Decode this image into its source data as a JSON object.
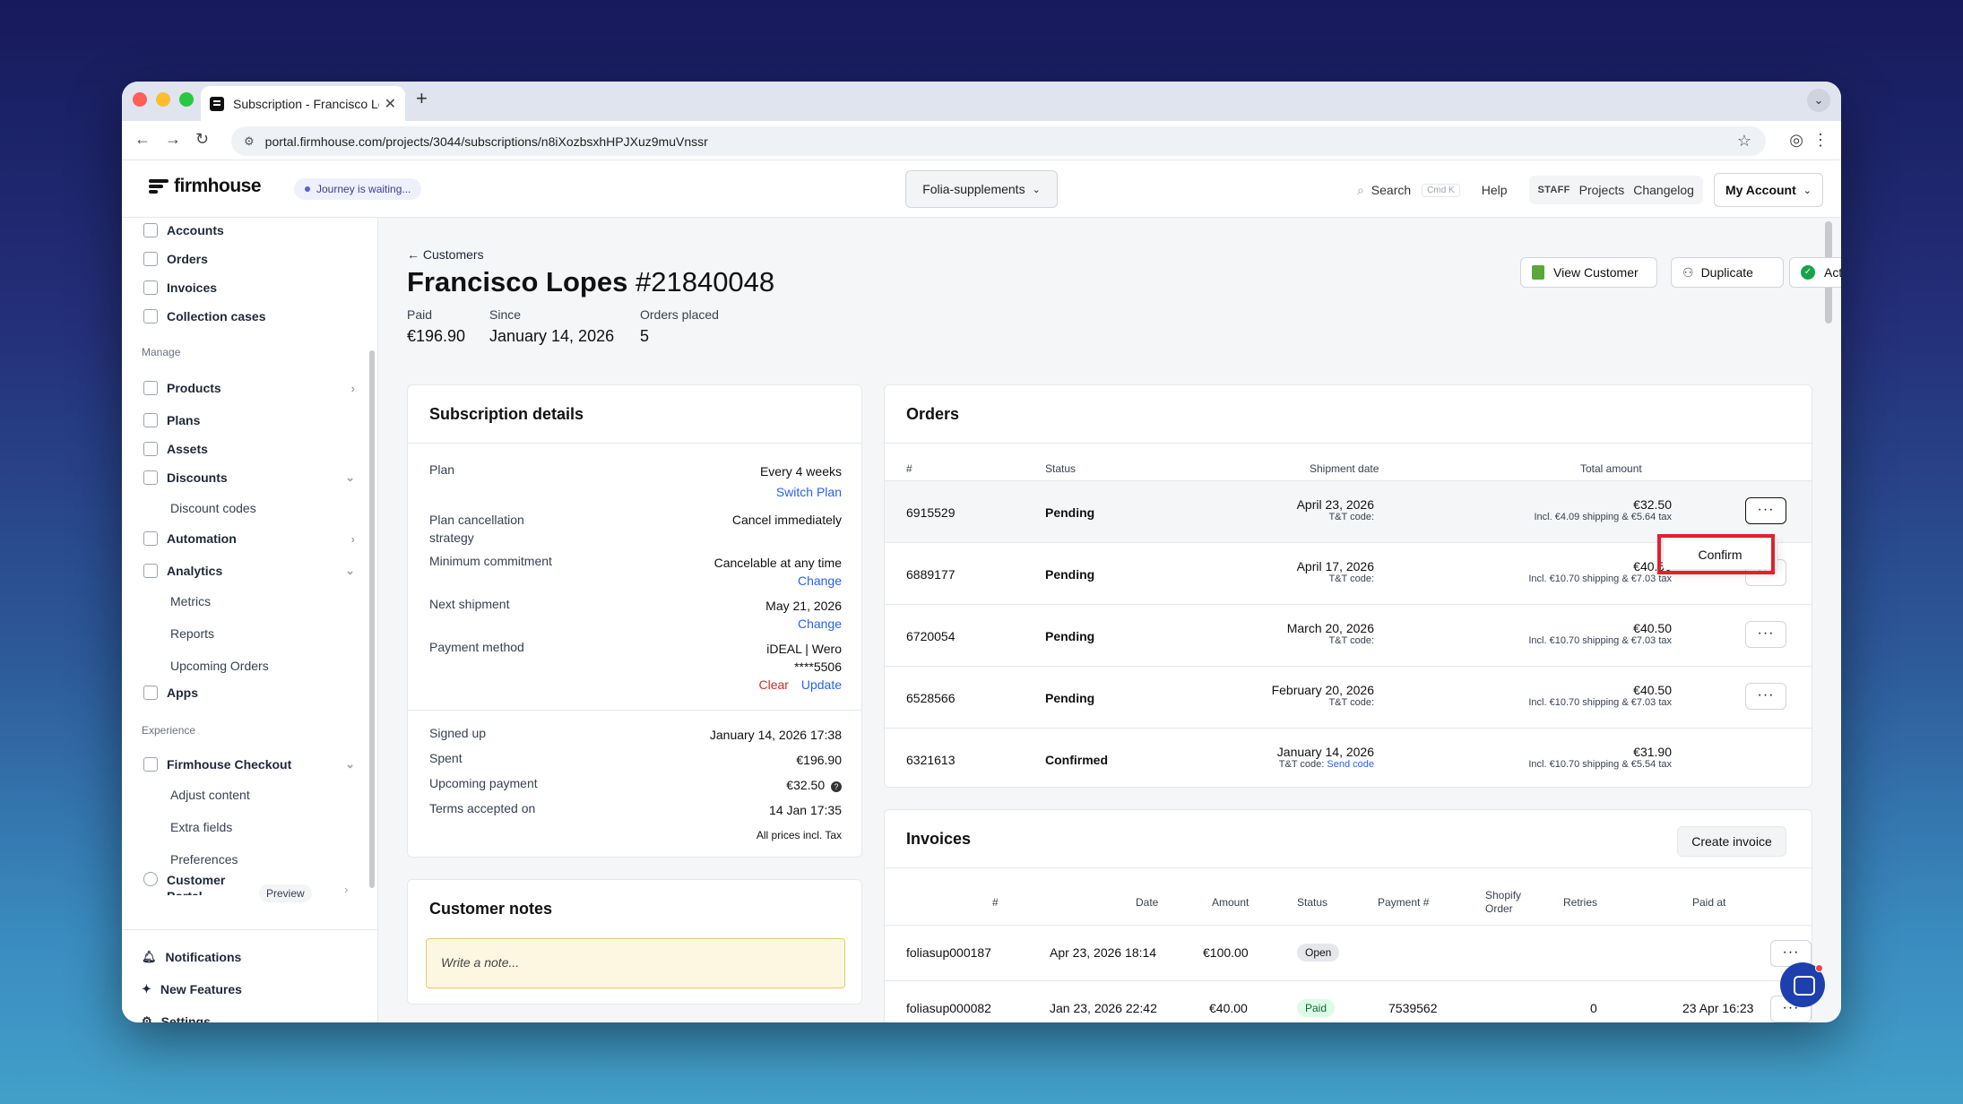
{
  "browser": {
    "tab_title": "Subscription - Francisco Lopes",
    "url": "portal.firmhouse.com/projects/3044/subscriptions/n8iXozbsxhHPJXuz9muVnssr"
  },
  "topnav": {
    "logo": "firmhouse",
    "journey": "Journey is waiting...",
    "project": "Folia-supplements",
    "search": "Search",
    "search_kbd": "Cmd K",
    "help": "Help",
    "staff": "STAFF",
    "projects": "Projects",
    "changelog": "Changelog",
    "account": "My Account"
  },
  "sidebar": {
    "accounts": "Accounts",
    "orders": "Orders",
    "invoices": "Invoices",
    "collection_cases": "Collection cases",
    "manage": "Manage",
    "products": "Products",
    "plans": "Plans",
    "assets": "Assets",
    "discounts": "Discounts",
    "discount_codes": "Discount codes",
    "automation": "Automation",
    "analytics": "Analytics",
    "metrics": "Metrics",
    "reports": "Reports",
    "upcoming_orders": "Upcoming Orders",
    "apps": "Apps",
    "experience": "Experience",
    "checkout": "Firmhouse Checkout",
    "adjust_content": "Adjust content",
    "extra_fields": "Extra fields",
    "preferences": "Preferences",
    "customer_portal": "Customer Portal",
    "preview": "Preview",
    "notifications": "Notifications",
    "new_features": "New Features",
    "settings": "Settings"
  },
  "header": {
    "breadcrumb": "Customers",
    "name": "Francisco Lopes",
    "number": "#21840048",
    "stats": [
      {
        "label": "Paid",
        "value": "€196.90"
      },
      {
        "label": "Since",
        "value": "January 14, 2026"
      },
      {
        "label": "Orders placed",
        "value": "5"
      }
    ],
    "view_customer": "View Customer",
    "duplicate": "Duplicate",
    "status": "Activated"
  },
  "subscription": {
    "title": "Subscription details",
    "plan_label": "Plan",
    "plan_value": "Every 4 weeks",
    "switch_plan": "Switch Plan",
    "cancel_label": "Plan cancellation strategy",
    "cancel_value": "Cancel immediately",
    "commit_label": "Minimum commitment",
    "commit_value": "Cancelable at any time",
    "change": "Change",
    "next_label": "Next shipment",
    "next_value": "May 21, 2026",
    "payment_label": "Payment method",
    "payment_value": "iDEAL | Wero",
    "payment_card": "****5506",
    "clear": "Clear",
    "update": "Update",
    "signed_label": "Signed up",
    "signed_value": "January 14, 2026 17:38",
    "spent_label": "Spent",
    "spent_value": "€196.90",
    "upcoming_label": "Upcoming payment",
    "upcoming_value": "€32.50",
    "terms_label": "Terms accepted on",
    "terms_value": "14 Jan 17:35",
    "prices_note": "All prices incl. Tax"
  },
  "notes": {
    "title": "Customer notes",
    "placeholder": "Write a note..."
  },
  "orders": {
    "title": "Orders",
    "headers": [
      "#",
      "Status",
      "Shipment date",
      "Total amount"
    ],
    "tt_label": "T&T code:",
    "send_code": "Send code",
    "rows": [
      {
        "id": "6915529",
        "status": "Pending",
        "date": "April 23, 2026",
        "total": "€32.50",
        "detail": "Incl. €4.09 shipping & €5.64 tax"
      },
      {
        "id": "6889177",
        "status": "Pending",
        "date": "April 17, 2026",
        "total": "€40.50",
        "detail": "Incl. €10.70 shipping & €7.03 tax"
      },
      {
        "id": "6720054",
        "status": "Pending",
        "date": "March 20, 2026",
        "total": "€40.50",
        "detail": "Incl. €10.70 shipping & €7.03 tax"
      },
      {
        "id": "6528566",
        "status": "Pending",
        "date": "February 20, 2026",
        "total": "€40.50",
        "detail": "Incl. €10.70 shipping & €7.03 tax"
      },
      {
        "id": "6321613",
        "status": "Confirmed",
        "date": "January 14, 2026",
        "total": "€31.90",
        "detail": "Incl. €10.70 shipping & €5.54 tax"
      }
    ],
    "confirm": "Confirm",
    "more": "···"
  },
  "invoices": {
    "title": "Invoices",
    "create": "Create invoice",
    "headers": [
      "#",
      "Date",
      "Amount",
      "Status",
      "Payment #",
      "Shopify Order",
      "Retries",
      "Paid at"
    ],
    "rows": [
      {
        "id": "foliasup000187",
        "date": "Apr 23, 2026 18:14",
        "amount": "€100.00",
        "status": "Open",
        "payment": "",
        "retries": "",
        "paid_at": ""
      },
      {
        "id": "foliasup000082",
        "date": "Jan 23, 2026 22:42",
        "amount": "€40.00",
        "status": "Paid",
        "payment": "7539562",
        "retries": "0",
        "paid_at": "23 Apr 16:23"
      }
    ]
  },
  "colors": {
    "accent": "#2563eb",
    "highlight": "#e0212e",
    "brand": "#111111"
  }
}
